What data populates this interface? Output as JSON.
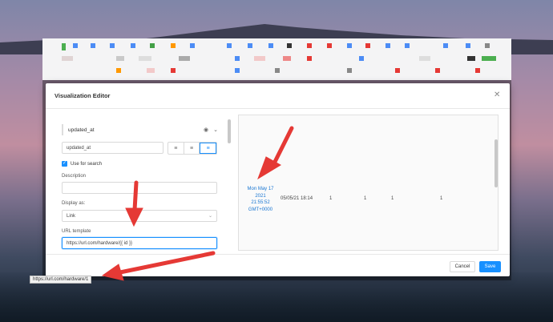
{
  "modal": {
    "title": "Visualization Editor"
  },
  "editor": {
    "column_name": "updated_at",
    "title_value": "updated_at",
    "use_for_search_label": "Use for search",
    "description_label": "Description",
    "description_value": "",
    "display_as_label": "Display as:",
    "display_as_value": "Link",
    "url_template_label": "URL template",
    "url_template_value": "https://url.com/hardware/{{ id }}"
  },
  "preview": {
    "date_lines": [
      "Mon May 17",
      "2021",
      "21:55:52",
      "GMT+0000"
    ],
    "cells": [
      "05/05/21 18:14",
      "1",
      "1",
      "1",
      "1"
    ]
  },
  "footer": {
    "cancel_label": "Cancel",
    "save_label": "Save"
  },
  "status_bar": {
    "url": "https://url.com/hardware/1"
  },
  "colors": {
    "accent": "#1890ff",
    "arrow": "#e53935"
  }
}
